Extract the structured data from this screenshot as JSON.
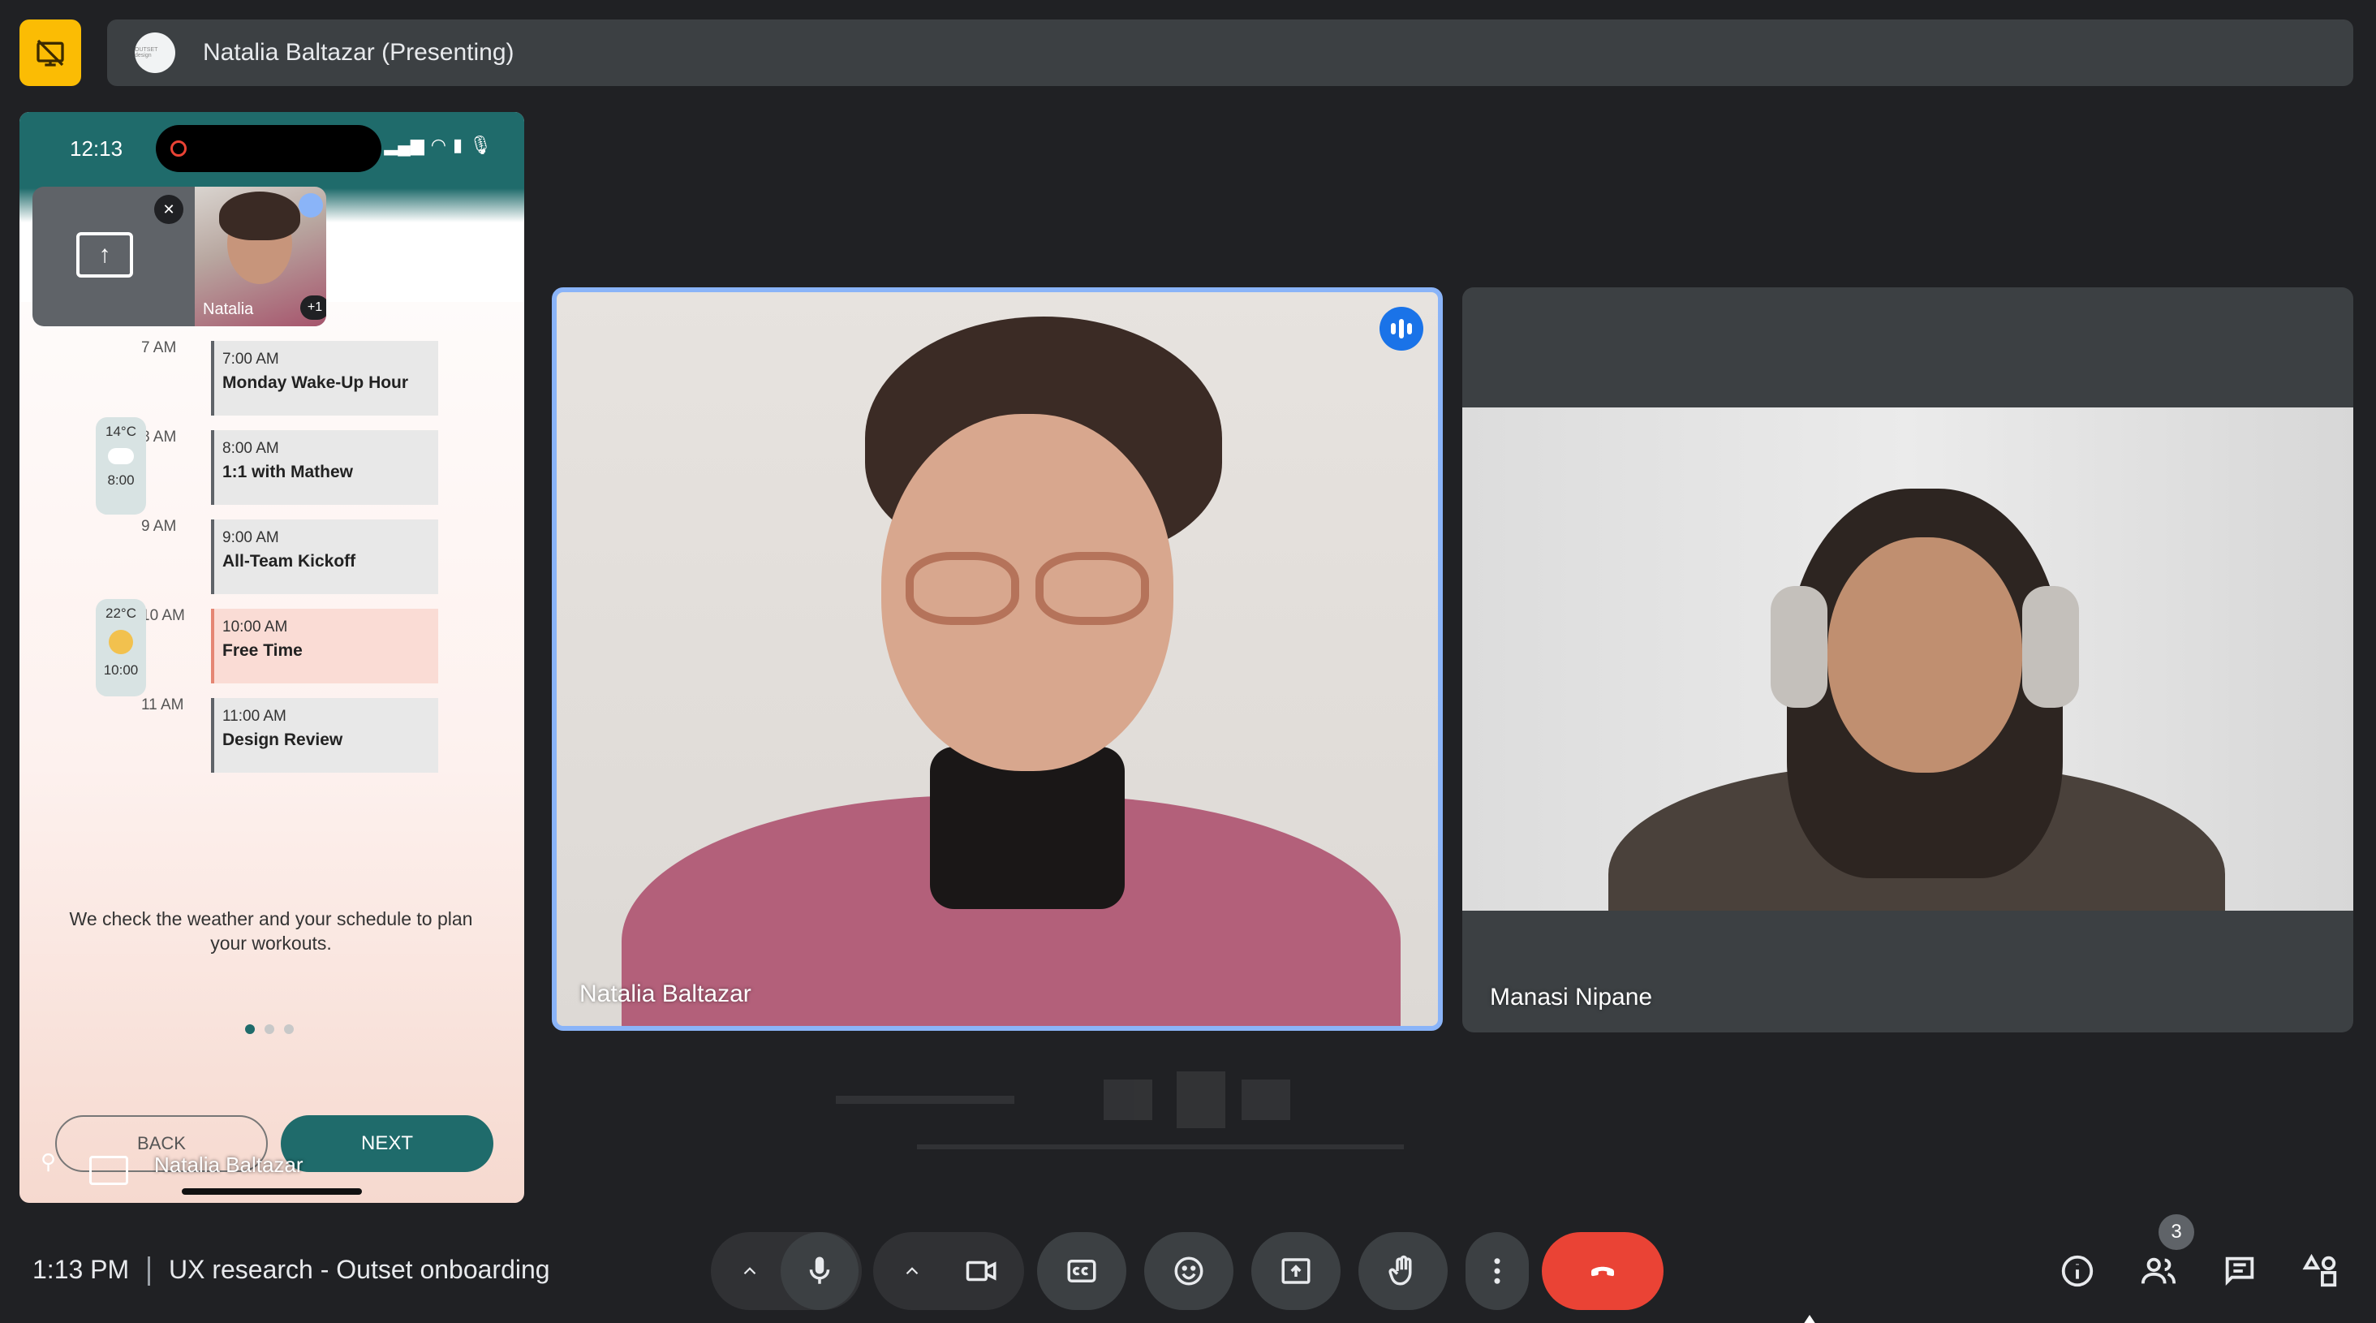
{
  "top_bar": {
    "presenter_label": "Natalia Baltazar (Presenting)",
    "avatar_text": "OUTSET design"
  },
  "phone": {
    "status_time": "12:13",
    "pip_name": "Natalia",
    "pip_extra": "+1",
    "schedule": [
      {
        "hour": "7 AM",
        "time": "7:00 AM",
        "name": "Monday Wake-Up Hour",
        "type": "normal"
      },
      {
        "hour": "8 AM",
        "time": "8:00 AM",
        "name": "1:1 with Mathew",
        "type": "normal"
      },
      {
        "hour": "9 AM",
        "time": "9:00 AM",
        "name": "All-Team Kickoff",
        "type": "normal"
      },
      {
        "hour": "10 AM",
        "time": "10:00 AM",
        "name": "Free Time",
        "type": "free"
      },
      {
        "hour": "11 AM",
        "time": "11:00 AM",
        "name": "Design Review",
        "type": "normal"
      }
    ],
    "weather": [
      {
        "temp": "14°C",
        "time": "8:00",
        "icon": "cloud-icon"
      },
      {
        "temp": "22°C",
        "time": "10:00",
        "icon": "sun-icon"
      }
    ],
    "onboarding_text": "We check the weather and your schedule to plan your workouts.",
    "page_total": 3,
    "page_active": 1,
    "back_label": "BACK",
    "next_label": "NEXT",
    "footer_name": "Natalia Baltazar"
  },
  "tiles": {
    "main_name": "Natalia Baltazar",
    "second_name": "Manasi Nipane"
  },
  "bottom_bar": {
    "time": "1:13 PM",
    "meeting_title": "UX research - Outset onboarding",
    "participants_count": "3"
  },
  "colors": {
    "accent_blue": "#8ab4f8",
    "end_call_red": "#ea4335",
    "present_yellow": "#fbbc04",
    "teal": "#1f6b6b"
  }
}
